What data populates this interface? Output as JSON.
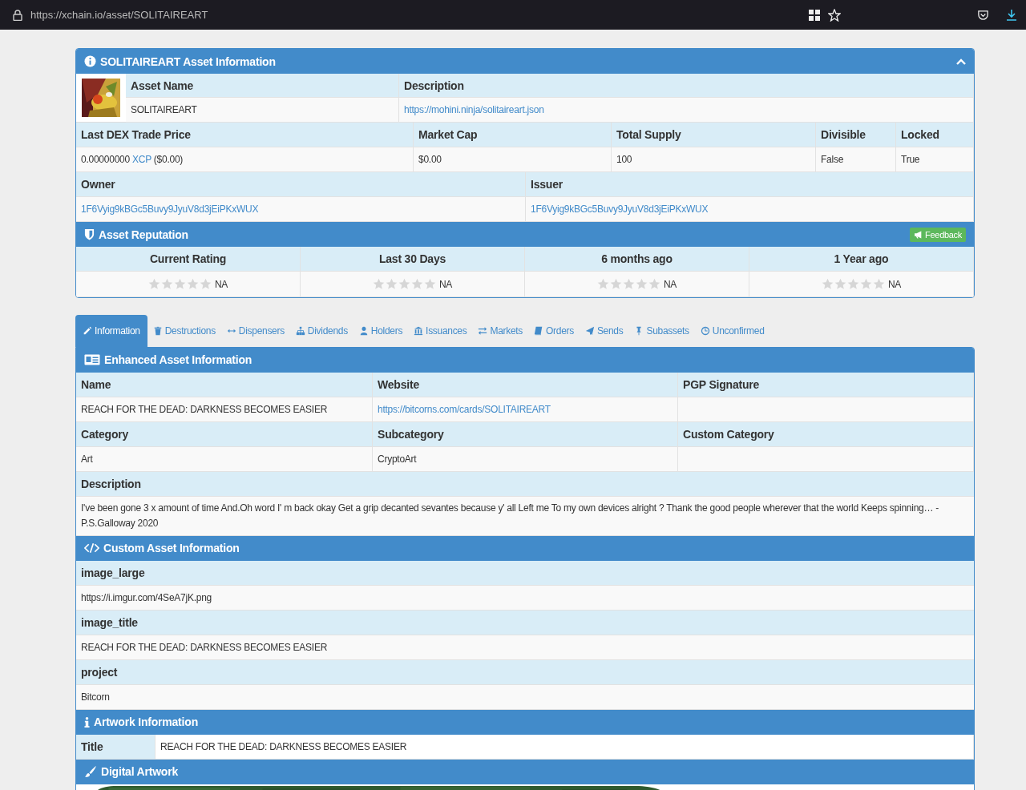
{
  "browser": {
    "url": "https://xchain.io/asset/SOLITAIREART"
  },
  "asset_info": {
    "title": "SOLITAIREART Asset Information",
    "top": [
      {
        "label": "Asset Name",
        "value": "SOLITAIREART",
        "kind": "text"
      },
      {
        "label": "Description",
        "value": "https://mohini.ninja/solitaireart.json",
        "kind": "link"
      }
    ],
    "market": [
      {
        "label": "Last DEX Trade Price",
        "kind": "price",
        "value": "0.00000000",
        "unit": "XCP",
        "fiat": "($0.00)"
      },
      {
        "label": "Market Cap",
        "value": "$0.00",
        "kind": "text"
      },
      {
        "label": "Total Supply",
        "value": "100",
        "kind": "text"
      },
      {
        "label": "Divisible",
        "value": "False",
        "kind": "text"
      },
      {
        "label": "Locked",
        "value": "True",
        "kind": "text"
      }
    ],
    "parties": [
      {
        "label": "Owner",
        "value": "1F6Vyig9kBGc5Buvy9JyuV8d3jEiPKxWUX",
        "kind": "link"
      },
      {
        "label": "Issuer",
        "value": "1F6Vyig9kBGc5Buvy9JyuV8d3jEiPKxWUX",
        "kind": "link"
      }
    ]
  },
  "reputation": {
    "title": "Asset Reputation",
    "button": "Feedback",
    "ratings": [
      {
        "label": "Current Rating",
        "stars": 0,
        "value": "NA"
      },
      {
        "label": "Last 30 Days",
        "stars": 0,
        "value": "NA"
      },
      {
        "label": "6 months ago",
        "stars": 0,
        "value": "NA"
      },
      {
        "label": "1 Year ago",
        "stars": 0,
        "value": "NA"
      }
    ]
  },
  "tabs": [
    {
      "label": "Information",
      "selected": true
    },
    {
      "label": "Destructions",
      "selected": false
    },
    {
      "label": "Dispensers",
      "selected": false
    },
    {
      "label": "Dividends",
      "selected": false
    },
    {
      "label": "Holders",
      "selected": false
    },
    {
      "label": "Issuances",
      "selected": false
    },
    {
      "label": "Markets",
      "selected": false
    },
    {
      "label": "Orders",
      "selected": false
    },
    {
      "label": "Sends",
      "selected": false
    },
    {
      "label": "Subassets",
      "selected": false
    },
    {
      "label": "Unconfirmed",
      "selected": false
    }
  ],
  "enhanced": {
    "title": "Enhanced Asset Information",
    "rows": [
      [
        {
          "label": "Name",
          "value": "REACH FOR THE DEAD: DARKNESS BECOMES EASIER",
          "kind": "text"
        },
        {
          "label": "Website",
          "value": "https://bitcorns.com/cards/SOLITAIREART",
          "kind": "link"
        },
        {
          "label": "PGP Signature"
        }
      ],
      [
        {
          "label": "Category",
          "value": "Art",
          "kind": "text"
        },
        {
          "label": "Subcategory",
          "value": "CryptoArt",
          "kind": "text"
        },
        {
          "label": "Custom Category"
        }
      ]
    ],
    "description": {
      "label": "Description",
      "value": "I've been gone 3 x amount of time And.Oh word I' m back okay Get a grip decanted sevantes because y' all Left me To my own devices alright ? Thank the good people wherever that the world Keeps spinning… - P.S.Galloway 2020"
    }
  },
  "custom": {
    "title": "Custom Asset Information",
    "fields": [
      {
        "label": "image_large",
        "value": "https://i.imgur.com/4SeA7jK.png"
      },
      {
        "label": "image_title",
        "value": "REACH FOR THE DEAD: DARKNESS BECOMES EASIER"
      },
      {
        "label": "project",
        "value": "Bitcorn"
      }
    ]
  },
  "artwork": {
    "title": "Artwork Information",
    "rows": [
      {
        "label": "Title",
        "value": "REACH FOR THE DEAD: DARKNESS BECOMES EASIER"
      }
    ]
  },
  "digital": {
    "title": "Digital Artwork"
  }
}
